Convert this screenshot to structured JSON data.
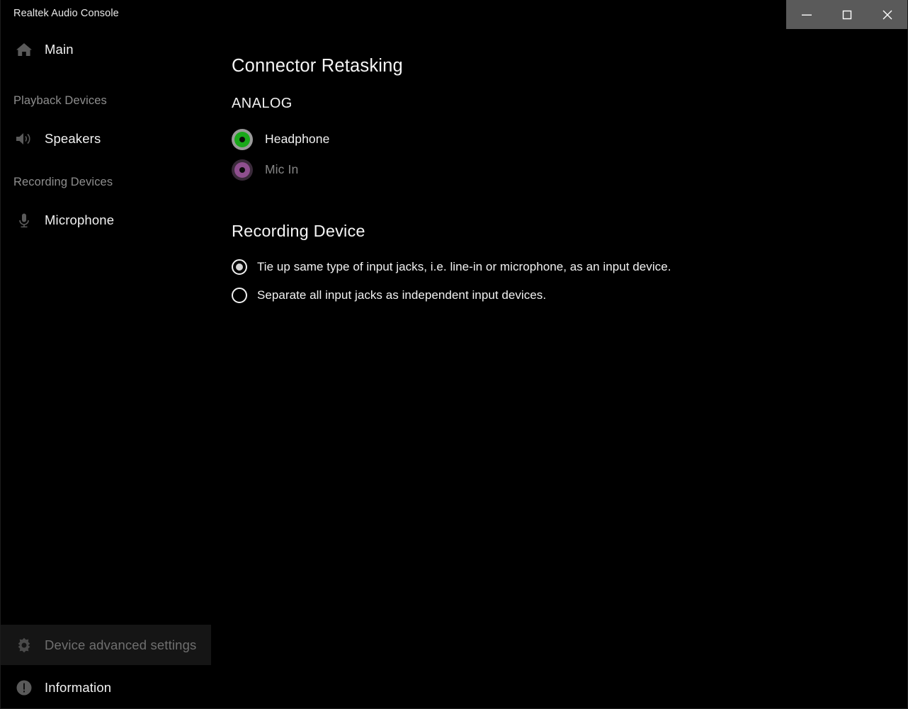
{
  "window": {
    "title": "Realtek Audio Console",
    "controls": {
      "minimize": "minimize-icon",
      "maximize": "maximize-icon",
      "close": "close-icon"
    },
    "controls_background": "#5a5a5a"
  },
  "sidebar": {
    "main_item": {
      "label": "Main",
      "icon": "home-icon"
    },
    "groups": [
      {
        "title": "Playback Devices",
        "items": [
          {
            "label": "Speakers",
            "icon": "speaker-icon"
          }
        ]
      },
      {
        "title": "Recording Devices",
        "items": [
          {
            "label": "Microphone",
            "icon": "microphone-icon"
          }
        ]
      }
    ],
    "bottom_items": [
      {
        "label": "Device advanced settings",
        "icon": "gear-icon",
        "selected": true,
        "dimmed": true
      },
      {
        "label": "Information",
        "icon": "info-icon",
        "selected": false,
        "dimmed": false
      }
    ]
  },
  "main": {
    "page_title": "Connector Retasking",
    "analog": {
      "section_label": "ANALOG",
      "jacks": [
        {
          "label": "Headphone",
          "color": "#1aa81a",
          "ring": "#9a9a9a",
          "enabled": true
        },
        {
          "label": "Mic In",
          "color": "#8f4f8f",
          "ring": "#3a2a3a",
          "enabled": false
        }
      ]
    },
    "recording_device": {
      "title": "Recording Device",
      "options": [
        {
          "label": "Tie up same type of input jacks, i.e. line-in or microphone, as an input device.",
          "selected": true
        },
        {
          "label": "Separate all input jacks as independent input devices.",
          "selected": false
        }
      ]
    }
  }
}
